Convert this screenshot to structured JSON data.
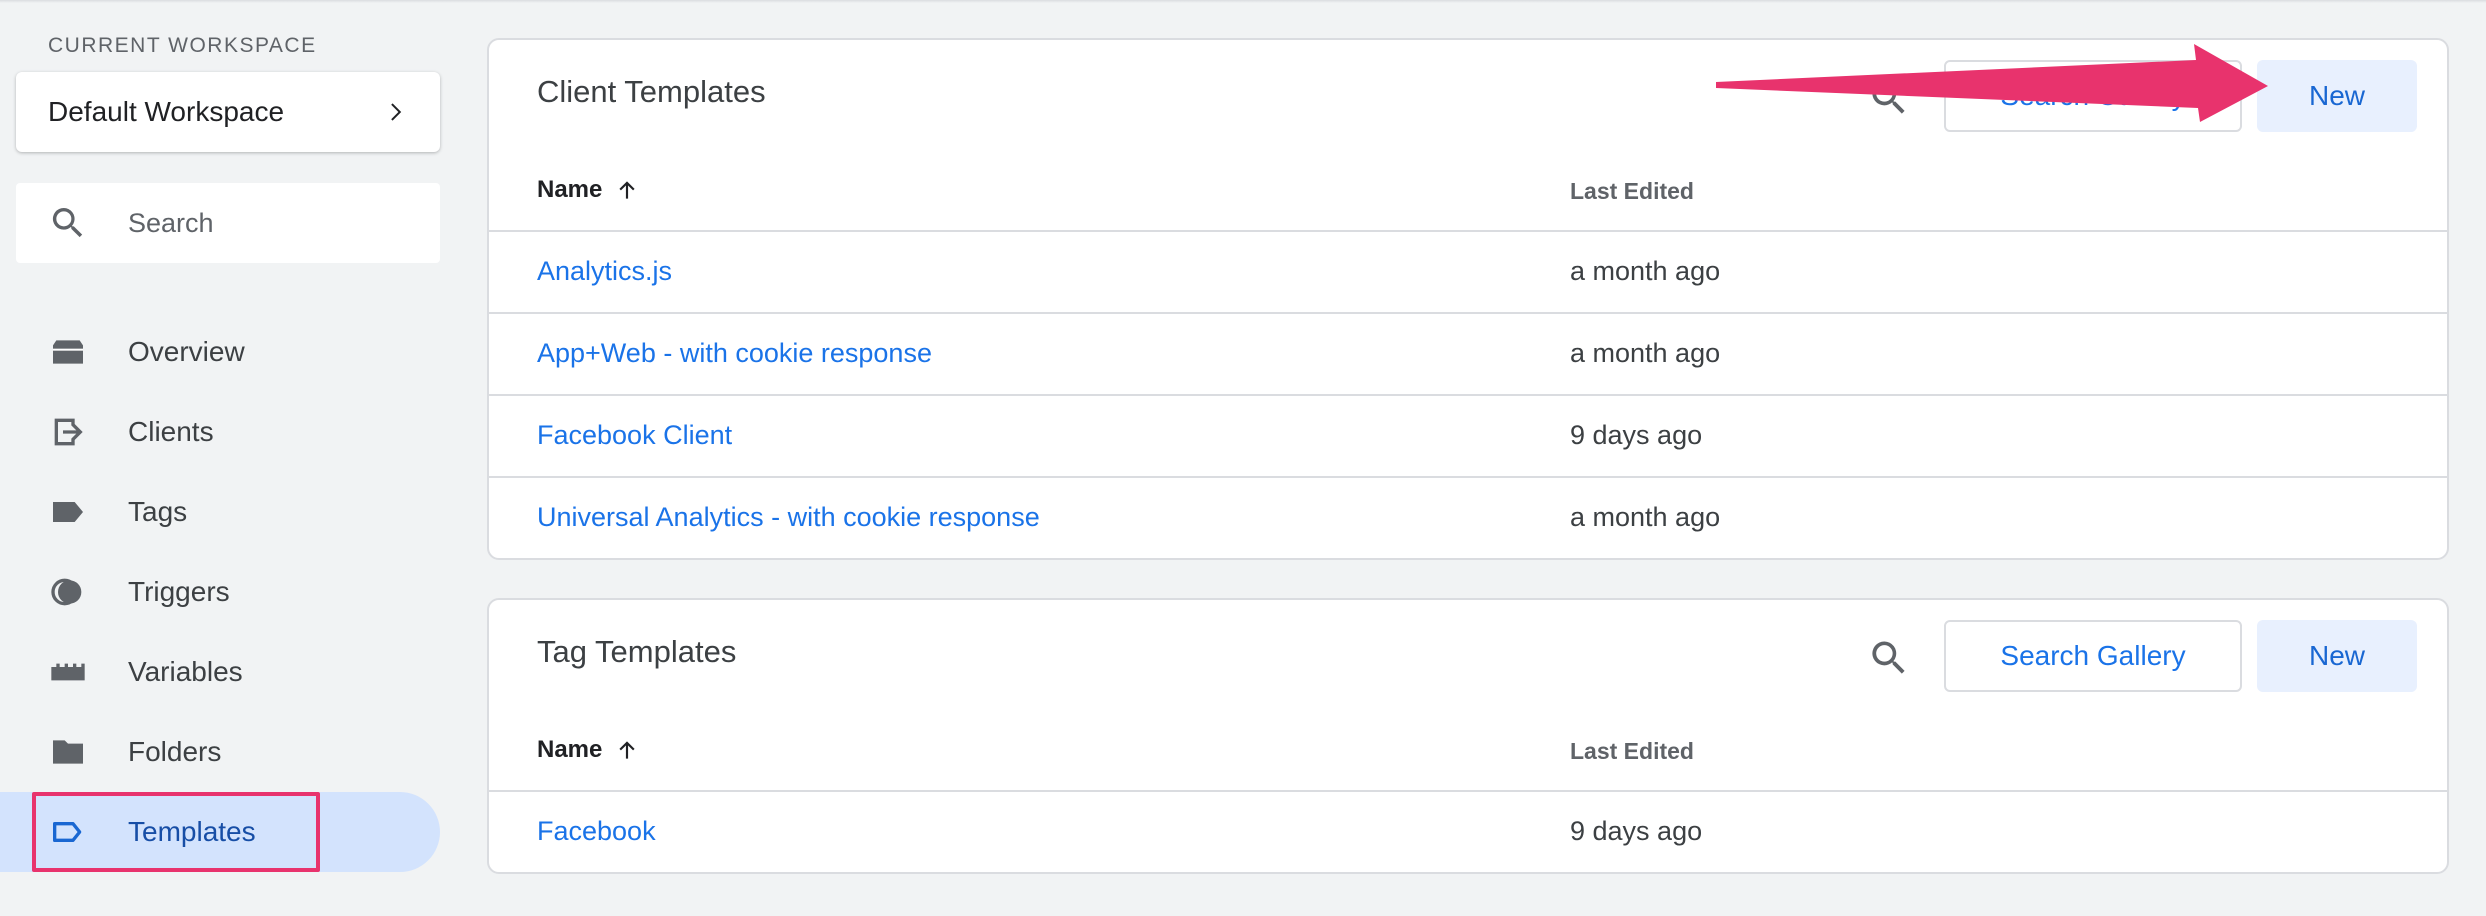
{
  "sidebar": {
    "workspace_label": "CURRENT WORKSPACE",
    "workspace_name": "Default Workspace",
    "search_placeholder": "Search",
    "items": [
      {
        "label": "Overview",
        "icon": "briefcase-icon"
      },
      {
        "label": "Clients",
        "icon": "login-icon"
      },
      {
        "label": "Tags",
        "icon": "label-icon"
      },
      {
        "label": "Triggers",
        "icon": "trigger-icon"
      },
      {
        "label": "Variables",
        "icon": "blocks-icon"
      },
      {
        "label": "Folders",
        "icon": "folder-icon"
      },
      {
        "label": "Templates",
        "icon": "label-outline-icon",
        "active": true
      }
    ]
  },
  "client_templates": {
    "title": "Client Templates",
    "search_gallery": "Search Gallery",
    "new": "New",
    "col_name": "Name",
    "col_edited": "Last Edited",
    "rows": [
      {
        "name": "Analytics.js",
        "edited": "a month ago"
      },
      {
        "name": "App+Web - with cookie response",
        "edited": "a month ago"
      },
      {
        "name": "Facebook Client",
        "edited": "9 days ago"
      },
      {
        "name": "Universal Analytics - with cookie response",
        "edited": "a month ago"
      }
    ]
  },
  "tag_templates": {
    "title": "Tag Templates",
    "search_gallery": "Search Gallery",
    "new": "New",
    "col_name": "Name",
    "col_edited": "Last Edited",
    "rows": [
      {
        "name": "Facebook",
        "edited": "9 days ago"
      }
    ]
  },
  "colors": {
    "accent": "#1a73e8",
    "annotation": "#e8336d",
    "active_nav_bg": "#d3e3fd"
  }
}
